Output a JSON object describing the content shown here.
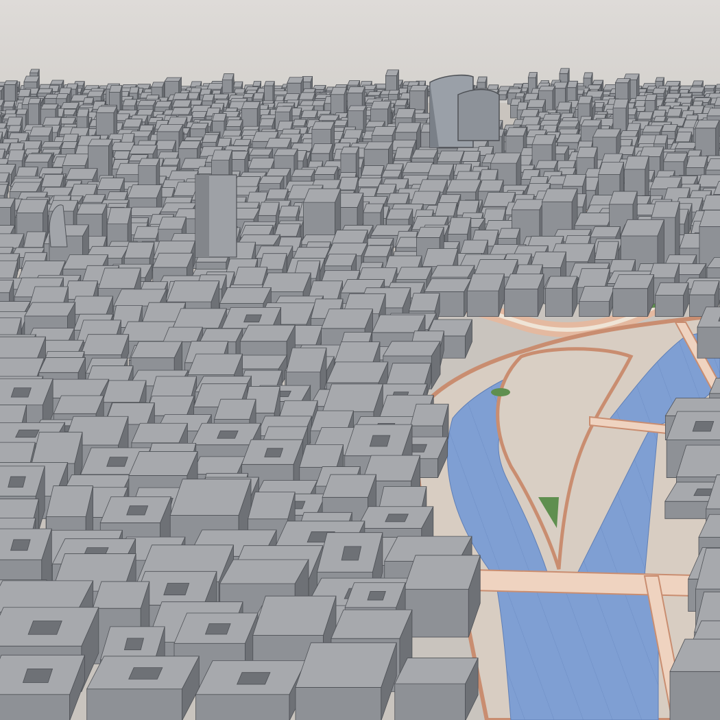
{
  "scene": {
    "kind": "3d-city-model-render",
    "colors": {
      "sky": "#d8d5d2",
      "ground": "#c9c4be",
      "street": "#e4b9a0",
      "street_edge": "#c98d70",
      "sidewalk": "#efe4d6",
      "water": "#7f9fd3",
      "water_line": "#5f7fb6",
      "grass": "#5f8f4f",
      "roof": "#a7a9ad",
      "wall_light": "#8e9196",
      "wall_dark": "#6e7176",
      "edge": "#4e5156"
    }
  }
}
